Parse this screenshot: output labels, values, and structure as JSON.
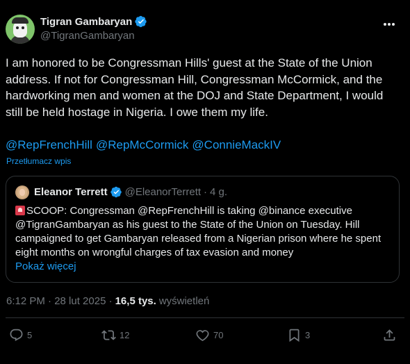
{
  "author": {
    "display_name": "Tigran Gambaryan",
    "handle": "@TigranGambaryan"
  },
  "tweet": {
    "text": "I am honored to be Congressman Hills' guest at the State of the Union address. If not for Congressman Hill, Congressman McCormick, and the hardworking men and women at the DOJ and State Department, I would still be held hostage in Nigeria. I owe them my life.",
    "mentions": [
      "@RepFrenchHill",
      "@RepMcCormick",
      "@ConnieMackIV"
    ],
    "translate_label": "Przetłumacz wpis"
  },
  "quote": {
    "display_name": "Eleanor Terrett",
    "handle": "@EleanorTerrett",
    "separator": "·",
    "time": "4 g.",
    "text": "SCOOP: Congressman @RepFrenchHill is taking @binance executive @TigranGambaryan as his guest to the State of the Union on Tuesday. Hill campaigned to get Gambaryan released from a Nigerian prison where he spent eight months on wrongful charges of tax evasion and money",
    "show_more": "Pokaż więcej"
  },
  "meta": {
    "timestamp": "6:12 PM · 28 lut 2025 ·",
    "views": "16,5 tys.",
    "views_label": "wyświetleń"
  },
  "actions": {
    "replies": "5",
    "reposts": "12",
    "likes": "70",
    "bookmarks": "3"
  },
  "colors": {
    "background": "#000000",
    "text": "#e7e9ea",
    "muted": "#71767b",
    "accent": "#1d9bf0",
    "border": "#2f3336"
  },
  "icons": [
    "verified-badge-icon",
    "more-icon",
    "reply-icon",
    "repost-icon",
    "like-icon",
    "bookmark-icon",
    "share-icon",
    "siren-icon"
  ]
}
